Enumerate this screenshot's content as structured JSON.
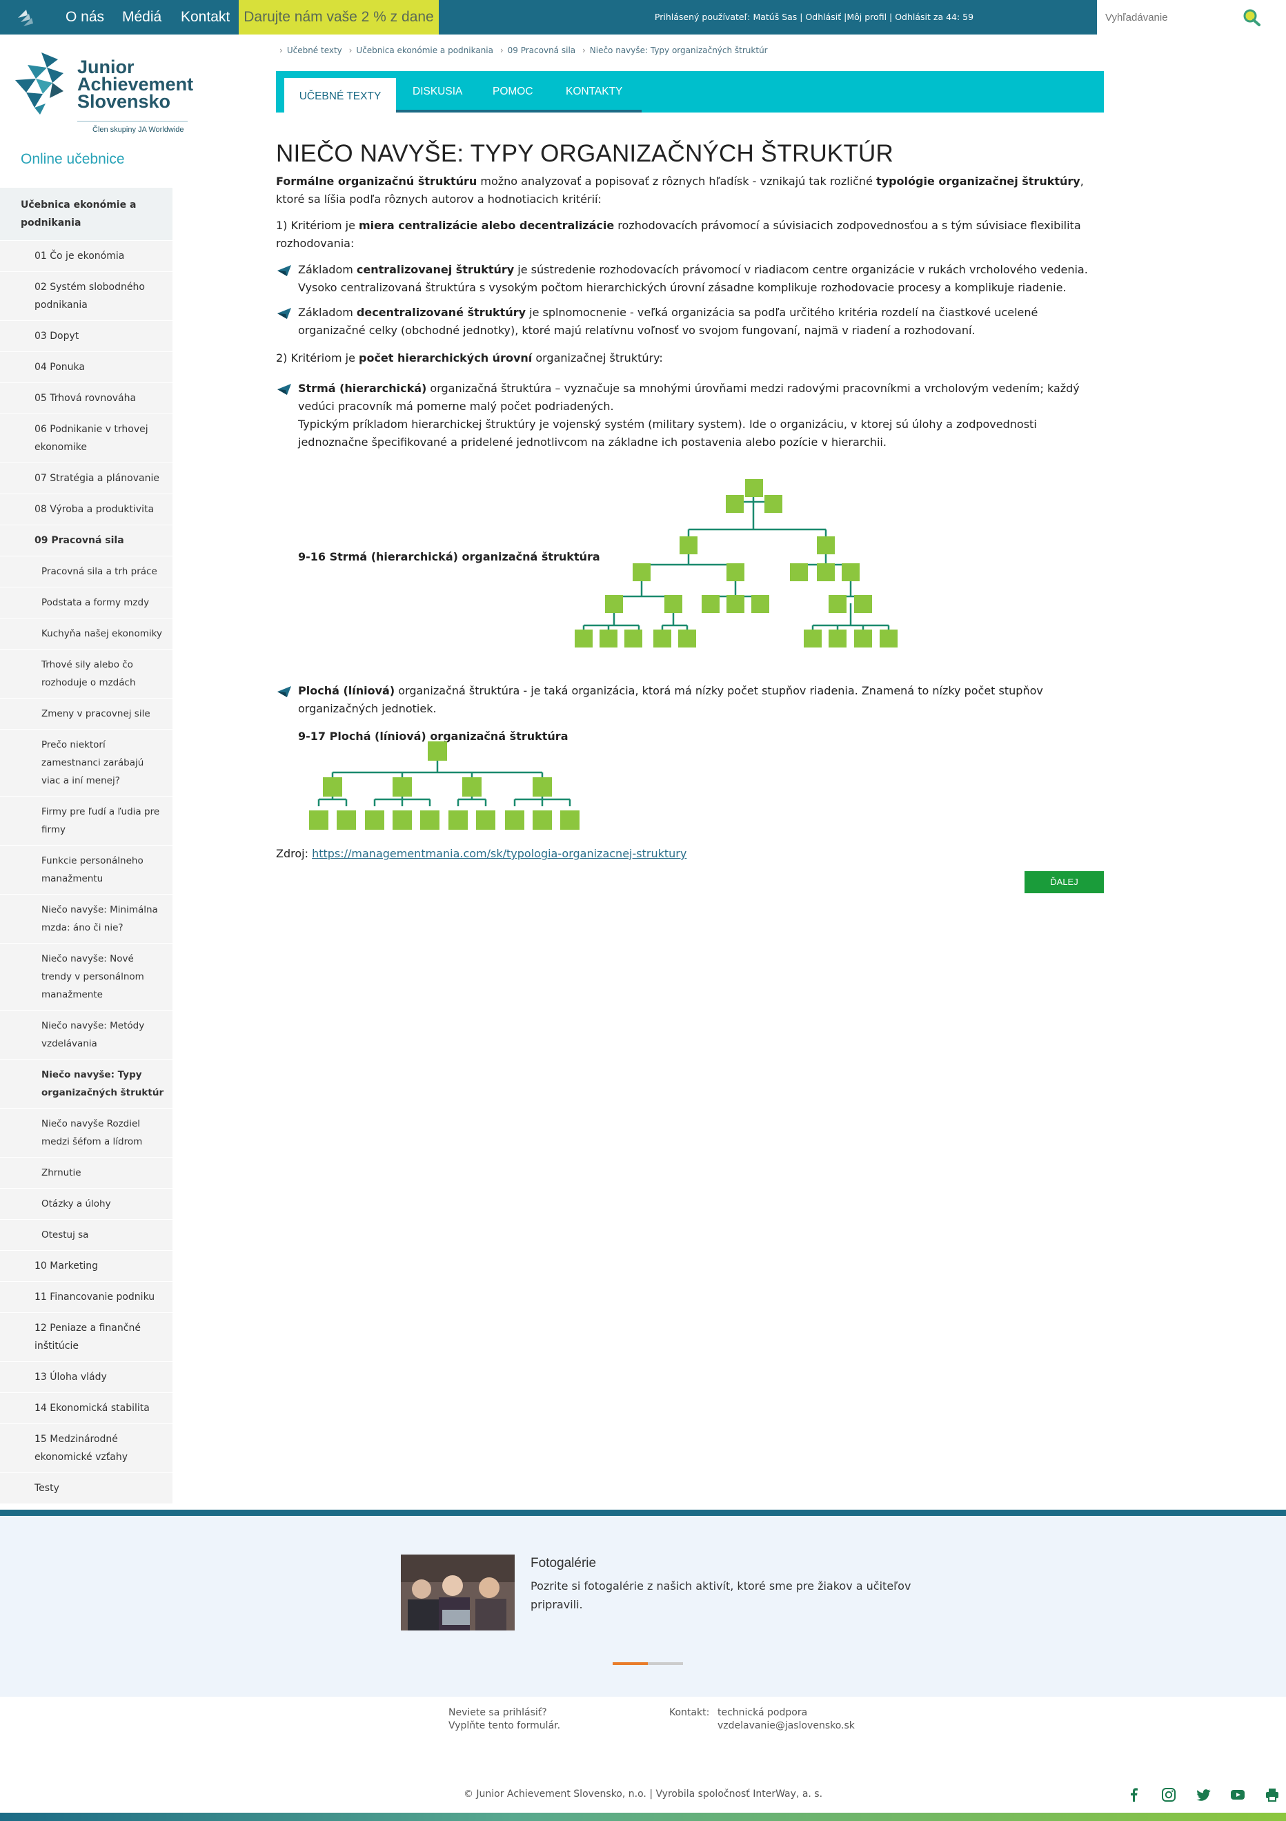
{
  "topbar": {
    "nav": [
      "O nás",
      "Médiá",
      "Kontakt"
    ],
    "donate": "Darujte nám vaše 2 % z dane",
    "user_info": "Prihlásený používateľ: Matúš Sas | Odhlásiť |Môj profil | Odhlásit za 44: 59",
    "search_placeholder": "Vyhľadávanie"
  },
  "logo": {
    "line1": "Junior",
    "line2": "Achievement",
    "line3": "Slovensko",
    "tagline": "Člen skupiny JA Worldwide"
  },
  "sidebar": {
    "title": "Online učebnice",
    "items": [
      {
        "label": "Učebnica ekonómie a podnikania",
        "level": 0
      },
      {
        "label": "01 Čo je ekonómia",
        "level": 1
      },
      {
        "label": "02 Systém slobodného podnikania",
        "level": 1
      },
      {
        "label": "03 Dopyt",
        "level": 1
      },
      {
        "label": "04 Ponuka",
        "level": 1
      },
      {
        "label": "05 Trhová rovnováha",
        "level": 1
      },
      {
        "label": "06 Podnikanie v trhovej ekonomike",
        "level": 1
      },
      {
        "label": "07 Stratégia a plánovanie",
        "level": 1
      },
      {
        "label": "08 Výroba a produktivita",
        "level": 1
      },
      {
        "label": "09 Pracovná sila",
        "level": 1,
        "bold": true
      },
      {
        "label": "Pracovná sila a trh práce",
        "level": 2
      },
      {
        "label": "Podstata a formy mzdy",
        "level": 2
      },
      {
        "label": "Kuchyňa našej ekonomiky",
        "level": 2
      },
      {
        "label": "Trhové sily alebo čo rozhoduje o mzdách",
        "level": 2
      },
      {
        "label": "Zmeny v pracovnej sile",
        "level": 2
      },
      {
        "label": "Prečo niektorí zamestnanci zarábajú viac a iní menej?",
        "level": 2
      },
      {
        "label": "Firmy pre ľudí a ľudia pre firmy",
        "level": 2
      },
      {
        "label": "Funkcie personálneho manažmentu",
        "level": 2
      },
      {
        "label": "Niečo navyše: Minimálna mzda: áno či nie?",
        "level": 2
      },
      {
        "label": "Niečo navyše: Nové trendy v personálnom manažmente",
        "level": 2
      },
      {
        "label": "Niečo navyše: Metódy vzdelávania",
        "level": 2
      },
      {
        "label": "Niečo navyše: Typy organizačných štruktúr",
        "level": 2,
        "bold": true
      },
      {
        "label": "Niečo navyše Rozdiel medzi šéfom a lídrom",
        "level": 2
      },
      {
        "label": "Zhrnutie",
        "level": 2
      },
      {
        "label": "Otázky a úlohy",
        "level": 2
      },
      {
        "label": "Otestuj sa",
        "level": 2
      },
      {
        "label": "10 Marketing",
        "level": 1
      },
      {
        "label": "11 Financovanie podniku",
        "level": 1
      },
      {
        "label": "12 Peniaze a finančné inštitúcie",
        "level": 1
      },
      {
        "label": "13 Úloha vlády",
        "level": 1
      },
      {
        "label": "14 Ekonomická stabilita",
        "level": 1
      },
      {
        "label": "15 Medzinárodné ekonomické vzťahy",
        "level": 1
      },
      {
        "label": "Testy",
        "level": 1
      }
    ]
  },
  "breadcrumb": [
    "Učebné texty",
    "Učebnica ekonómie a podnikania",
    "09 Pracovná sila",
    "Niečo navyše: Typy organizačných štruktúr"
  ],
  "tabs": [
    "UČEBNÉ TEXTY",
    "DISKUSIA",
    "POMOC",
    "KONTAKTY"
  ],
  "content": {
    "title": "NIEČO NAVYŠE: TYPY ORGANIZAČNÝCH ŠTRUKTÚR",
    "intro_b1": "Formálne organizačnú štruktúru",
    "intro_t1": " možno analyzovať a popisovať z rôznych hľadísk - vznikajú tak rozličné ",
    "intro_b2": "typológie organizačnej štruktúry",
    "intro_t2": ", ktoré sa líšia podľa rôznych autorov a hodnotiacich kritérií:",
    "crit1_t1": "1) Kritériom je ",
    "crit1_b": "miera centralizácie alebo decentralizácie",
    "crit1_t2": " rozhodovacích právomocí a súvisiacich zodpovednosťou a s tým súvisiace flexibilita rozhodovania:",
    "b1_t1": "Základom ",
    "b1_b": "centralizovanej štruktúry",
    "b1_t2": " je sústredenie rozhodovacích právomocí v riadiacom centre organizácie v rukách vrcholového vedenia. Vysoko centralizovaná štruktúra s vysokým počtom hierarchických úrovní zásadne komplikuje rozhodovacie procesy a komplikuje riadenie.",
    "b2_t1": "Základom ",
    "b2_b": "decentralizované štruktúry",
    "b2_t2": " je splnomocnenie - veľká organizácia sa podľa určitého kritéria rozdelí na čiastkové ucelené organizačné celky (obchodné jednotky), ktoré majú relatívnu voľnosť vo svojom fungovaní, najmä v riadení a rozhodovaní.",
    "crit2_t1": "2) Kritériom je ",
    "crit2_b": "počet hierarchických úrovní",
    "crit2_t2": " organizačnej štruktúry:",
    "b3_b": "Strmá (hierarchická)",
    "b3_t1": " organizačná štruktúra – vyznačuje sa mnohými úrovňami medzi radovými pracovníkmi a vrcholovým vedením; každý vedúci pracovník má pomerne malý počet podriadených.",
    "b3_t2": "Typickým príkladom hierarchickej štruktúry je vojenský systém (military system). Ide o organizáciu, v ktorej sú úlohy a zodpovednosti jednoznačne špecifikované a pridelené jednotlivcom na základne ich postavenia alebo pozície v hierarchii.",
    "fig1_caption": "9-16 Strmá (hierarchická) organizačná štruktúra",
    "b4_b": "Plochá (líniová)",
    "b4_t1": " organizačná štruktúra - je taká organizácia, ktorá má nízky počet stupňov riadenia. Znamená to nízky počet stupňov organizačných jednotiek.",
    "fig2_caption": "9-17 Plochá (líniová) organizačná štruktúra",
    "source_label": "Zdroj: ",
    "source_link": "https://managementmania.com/sk/typologia-organizacnej-struktury",
    "next_button": "ĎALEJ"
  },
  "footer": {
    "gallery_title": "Fotogalérie",
    "gallery_text": "Pozrite si fotogalérie z našich aktivít, ktoré sme pre žiakov a učiteľov pripravili.",
    "login_q": "Neviete sa prihlásiť?",
    "login_a": "Vyplňte tento formulár.",
    "contact_label": "Kontakt:",
    "contact_1": "technická podpora",
    "contact_2": "vzdelavanie@jaslovensko.sk",
    "copyright": "© Junior Achievement Slovensko, n.o. | Vyrobila spoločnosť InterWay, a. s."
  },
  "colors": {
    "primary": "#1c6b86",
    "tabs": "#00bfcc",
    "donate": "#d8e03a",
    "node": "#8cc63e",
    "line": "#1a8a6e",
    "next": "#1a9c3a"
  }
}
